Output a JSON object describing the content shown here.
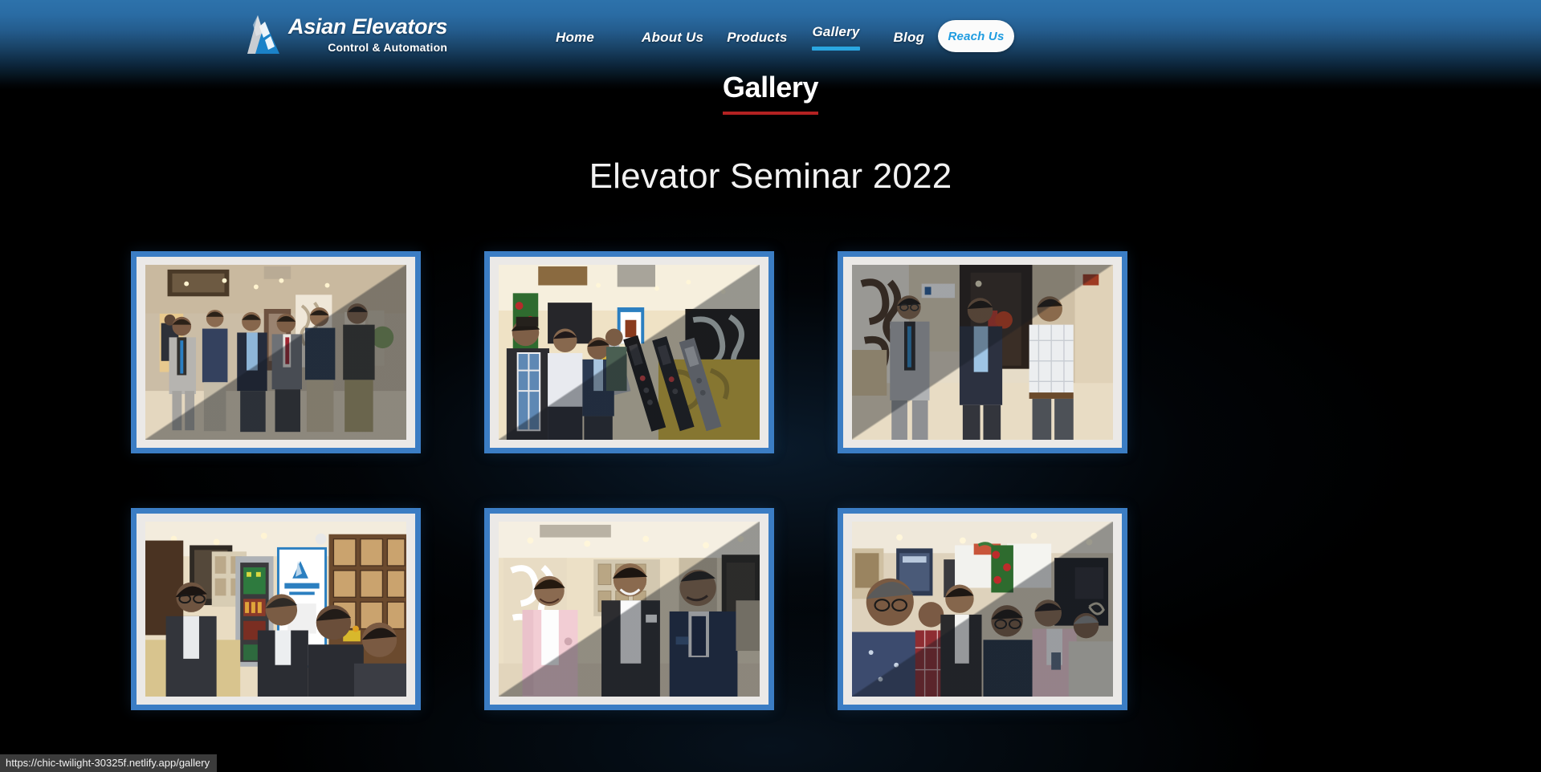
{
  "browser": {
    "status_url": "https://chic-twilight-30325f.netlify.app/gallery"
  },
  "header": {
    "logo": {
      "icon": "triangle-mountain-logo-icon",
      "title": "Asian Elevators",
      "subtitle": "Control & Automation"
    },
    "nav": [
      {
        "id": "home",
        "label": "Home",
        "active": false
      },
      {
        "id": "about",
        "label": "About Us",
        "active": false
      },
      {
        "id": "products",
        "label": "Products",
        "active": false
      },
      {
        "id": "gallery",
        "label": "Gallery",
        "active": true
      },
      {
        "id": "blog",
        "label": "Blog",
        "active": false
      }
    ],
    "cta": {
      "label": "Reach Us"
    },
    "colors": {
      "gradient_top": "#2d72ab",
      "gradient_bottom": "#000000",
      "active_underline": "#2aa6e0",
      "cta_text": "#1f9ce0",
      "cta_background": "#fbfbfb"
    }
  },
  "page": {
    "title": "Gallery",
    "title_underline_color": "#b32222",
    "section_title": "Elevator Seminar 2022",
    "background_color": "#000000"
  },
  "gallery": {
    "frame_color": "#3b7dc4",
    "mat_color": "#ebe9e7",
    "items": [
      {
        "id": "photo-1",
        "caption": "Six men in business attire posing together in a hotel lobby at the elevator seminar",
        "sheen": "br"
      },
      {
        "id": "photo-2",
        "caption": "Attendees inspecting elevator control panels and car operating panels at an exhibition booth",
        "sheen": "br"
      },
      {
        "id": "photo-3",
        "caption": "Three men standing together in front of an elevator door at the venue",
        "sheen": "tr"
      },
      {
        "id": "photo-4",
        "caption": "Delegates viewing an open elevator controller cabinet beside an Asian Elevators banner",
        "sheen": "none"
      },
      {
        "id": "photo-5",
        "caption": "Three men greeting and talking, one wearing a pink blazer",
        "sheen": "br"
      },
      {
        "id": "photo-6",
        "caption": "Crowd of seminar attendees gathered near the projector screens",
        "sheen": "br"
      }
    ]
  }
}
